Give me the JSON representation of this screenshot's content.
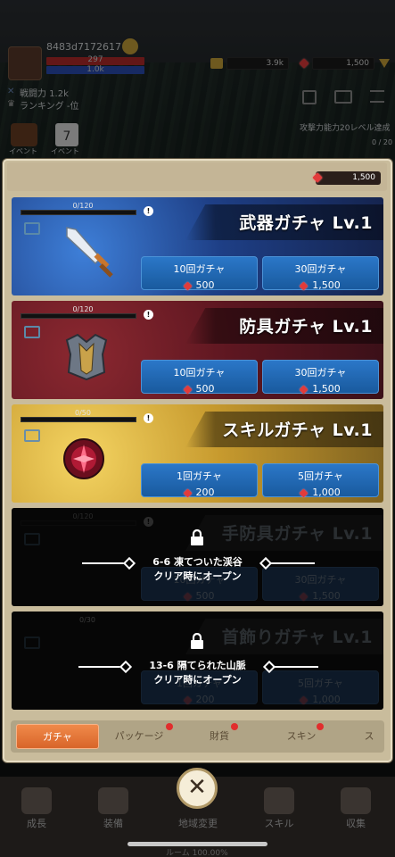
{
  "hud": {
    "player_name": "8483d7172617",
    "hp_value": "297",
    "exp_value": "1.0k",
    "combat_power_label": "戦闘力 1.2k",
    "ranking_label": "ランキング -位",
    "gold": "3.9k",
    "gems": "1,500",
    "event_label_1": "イベント",
    "event_label_2": "イベント",
    "event_day": "7",
    "quest_text": "攻撃力能力20レベル達成",
    "quest_progress": "0 / 20"
  },
  "popup": {
    "gem_balance": "1,500",
    "cards": [
      {
        "title": "武器ガチャ Lv.1",
        "progress": "0/120",
        "buttons": [
          {
            "label": "10回ガチャ",
            "cost": "500"
          },
          {
            "label": "30回ガチャ",
            "cost": "1,500"
          }
        ]
      },
      {
        "title": "防具ガチャ Lv.1",
        "progress": "0/120",
        "buttons": [
          {
            "label": "10回ガチャ",
            "cost": "500"
          },
          {
            "label": "30回ガチャ",
            "cost": "1,500"
          }
        ]
      },
      {
        "title": "スキルガチャ Lv.1",
        "progress": "0/50",
        "buttons": [
          {
            "label": "1回ガチャ",
            "cost": "200"
          },
          {
            "label": "5回ガチャ",
            "cost": "1,000"
          }
        ]
      },
      {
        "title": "手防具ガチャ Lv.1",
        "progress": "0/120",
        "buttons": [
          {
            "label": "10回ガチャ",
            "cost": "500"
          },
          {
            "label": "30回ガチャ",
            "cost": "1,500"
          }
        ],
        "lock_line1": "6-6 凍てついた渓谷",
        "lock_line2": "クリア時にオープン"
      },
      {
        "title": "首飾りガチャ Lv.1",
        "progress": "0/30",
        "buttons": [
          {
            "label": "1回ガチャ",
            "cost": "200"
          },
          {
            "label": "5回ガチャ",
            "cost": "1,000"
          }
        ],
        "lock_line1": "13-6 隔てられた山脈",
        "lock_line2": "クリア時にオープン"
      }
    ],
    "tabs": [
      "ガチャ",
      "パッケージ",
      "財貨",
      "スキン",
      "ス"
    ]
  },
  "bottom_nav": {
    "items": [
      "成長",
      "装備",
      "地域変更",
      "スキル",
      "収集"
    ],
    "footer_text": "ルーム 100.00%"
  },
  "colors": {
    "accent": "#e8743a",
    "button_blue": "#2469b4",
    "gem": "#e23b3b"
  }
}
